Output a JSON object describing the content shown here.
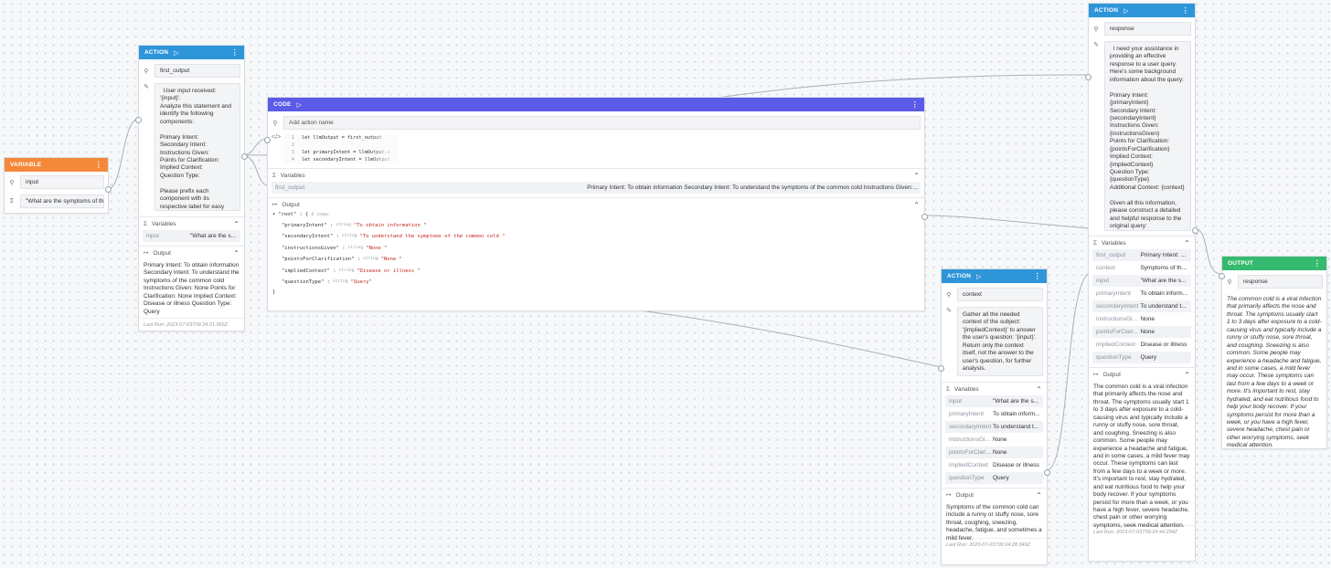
{
  "colors": {
    "variable_header": "#f5893a",
    "action_header": "#2f95d9",
    "code_header": "#5b5be8",
    "output_header": "#35ba6f",
    "wire": "#a9b1bb",
    "json_string": "#c2281f"
  },
  "icons": {
    "play": "play-icon",
    "menu": "kebab-menu-icon",
    "name": "variable-name-icon",
    "edit": "pencil-icon",
    "sigma": "sigma-icon",
    "code": "code-icon",
    "output": "output-arrow-icon",
    "collapse": "chevron-up-icon"
  },
  "variable_node": {
    "header": "VARIABLE",
    "name": "input",
    "value": "\"What are the symptoms of the"
  },
  "action1": {
    "header": "ACTION",
    "name": "first_output",
    "prompt": "  User input received: '{input}'.\nAnalyze this statement and identify the following components:\n\nPrimary Intent:\nSecondary Intent:\nInstructions Given:\nPoints for Clarification:\nImplied Context:\nQuestion Type:\n\nPlease prefix each component with its respective label for easy extraction.",
    "variables_label": "Variables",
    "variables": [
      {
        "k": "input",
        "v": "\"What are the s..."
      }
    ],
    "output_label": "Output",
    "output": "Primary Intent: To obtain information Secondary Intent: To understand the symptoms of the common cold Instructions Given: None Points for Clarification: None Implied Context: Disease or illness Question Type: Query",
    "last_run": "Last Run: 2023-07-03T09:24:21.965Z"
  },
  "code_node": {
    "header": "CODE",
    "name_placeholder": "Add action name",
    "code_lines": [
      {
        "n": "1",
        "t": "let llmOutput = first_output"
      },
      {
        "n": "2",
        "t": ""
      },
      {
        "n": "3",
        "t": "let primaryIntent = llmOutput.s"
      },
      {
        "n": "4",
        "t": "let secondaryIntent = llmOutput"
      },
      {
        "n": "5",
        "t": "let instructionsGiven = llmOutpu"
      }
    ],
    "variables_label": "Variables",
    "variable_key": "first_output",
    "variable_value": "Primary Intent: To obtain information Secondary Intent: To understand the symptoms of the common cold Instructions Given:...",
    "output_label": "Output",
    "json_root": "\"root\" : {",
    "json_root_count": "6 items",
    "json_close": "}",
    "json_items": [
      {
        "k": "\"primaryIntent\"",
        "t": "string",
        "v": "\"To obtain information \""
      },
      {
        "k": "\"secondaryIntent\"",
        "t": "string",
        "v": "\"To understand the symptoms of the common cold \""
      },
      {
        "k": "\"instructionsGiven\"",
        "t": "string",
        "v": "\"None \""
      },
      {
        "k": "\"pointsForClarification\"",
        "t": "string",
        "v": "\"None \""
      },
      {
        "k": "\"impliedContext\"",
        "t": "string",
        "v": "\"Disease or illness \""
      },
      {
        "k": "\"questionType\"",
        "t": "string",
        "v": "\"Query\""
      }
    ]
  },
  "action2": {
    "header": "ACTION",
    "name": "context",
    "prompt": "Gather all the needed context of the subject: '{impliedContext}' to answer the user's question: '{input}'.\nReturn only the context itself, not the answer to the user's question, for further analysis.",
    "variables_label": "Variables",
    "variables": [
      {
        "k": "input",
        "v": "\"What are the s..."
      },
      {
        "k": "primaryIntent",
        "v": "To obtain inform..."
      },
      {
        "k": "secondaryIntent",
        "v": "To understand t..."
      },
      {
        "k": "instructionsGiven",
        "v": "None"
      },
      {
        "k": "pointsForClarific...",
        "v": "None"
      },
      {
        "k": "impliedContext",
        "v": "Disease or illness"
      },
      {
        "k": "questionType",
        "v": "Query"
      }
    ],
    "output_label": "Output",
    "output": "Symptoms of the common cold can include a runny or stuffy nose, sore throat, coughing, sneezing, headache, fatigue, and sometimes a mild fever.",
    "last_run": "Last Run: 2023-07-03T09:24:28.349Z"
  },
  "action3": {
    "header": "ACTION",
    "name": "response",
    "prompt": "  I need your assistance in providing an effective response to a user query. Here's some background information about the query:\n\nPrimary Intent: {primaryIntent}\nSecondary Intent: {secondaryIntent}\nInstructions Given: {instructionsGiven}\nPoints for Clarification: {pointsForClarification}\nImplied Context: {impliedContext}\nQuestion Type: {questionType}\nAdditional Context: {context}\n\nGiven all this information, please construct a detailed and helpful response to the original query:\n\n\"{input}\".\nReturn only the response itself.",
    "variables_label": "Variables",
    "variables": [
      {
        "k": "first_output",
        "v": "Primary Intent: T..."
      },
      {
        "k": "context",
        "v": "Symptoms of th..."
      },
      {
        "k": "input",
        "v": "\"What are the s..."
      },
      {
        "k": "primaryIntent",
        "v": "To obtain inform..."
      },
      {
        "k": "secondaryIntent",
        "v": "To understand t..."
      },
      {
        "k": "instructionsGiven",
        "v": "None"
      },
      {
        "k": "pointsForClarific...",
        "v": "None"
      },
      {
        "k": "impliedContext",
        "v": "Disease or illness"
      },
      {
        "k": "questionType",
        "v": "Query"
      }
    ],
    "output_label": "Output",
    "output": "The common cold is a viral infection that primarily affects the nose and throat. The symptoms usually start 1 to 3 days after exposure to a cold-causing virus and typically include a runny or stuffy nose, sore throat, and coughing. Sneezing is also common. Some people may experience a headache and fatigue, and in some cases, a mild fever may occur. These symptoms can last from a few days to a week or more. It's important to rest, stay hydrated, and eat nutritious food to help your body recover. If your symptoms persist for more than a week, or you have a high fever, severe headache, chest pain or other worrying symptoms, seek medical attention.",
    "last_run": "Last Run: 2023-07-03T09:24:44.294Z"
  },
  "output_node": {
    "header": "OUTPUT",
    "name": "response",
    "text": "The common cold is a viral infection that primarily affects the nose and throat. The symptoms usually start 1 to 3 days after exposure to a cold-causing virus and typically include a runny or stuffy nose, sore throat, and coughing. Sneezing is also common. Some people may experience a headache and fatigue, and in some cases, a mild fever may occur. These symptoms can last from a few days to a week or more. It's important to rest, stay hydrated, and eat nutritious food to help your body recover. If your symptoms persist for more than a week, or you have a high fever, severe headache, chest pain or other worrying symptoms, seek medical attention."
  }
}
